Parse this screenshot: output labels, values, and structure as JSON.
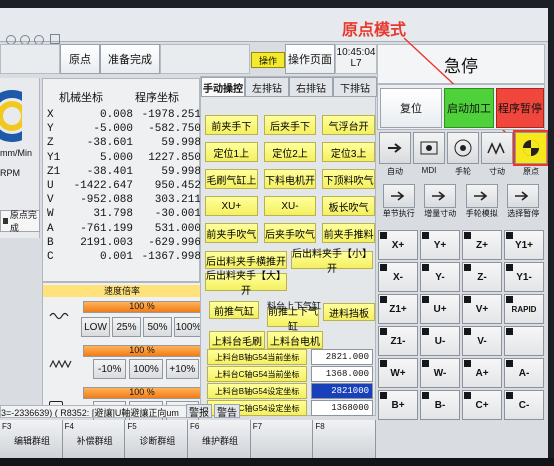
{
  "overlay_title": "原点模式",
  "header": {
    "origin": "原点",
    "ready": "准备完成",
    "op_badge": "操作",
    "op_page": "操作页面",
    "time": "10:45:04",
    "line": "L7",
    "estop": "急停"
  },
  "left_info": {
    "speed_unit": "mm/Min",
    "rpm": "RPM",
    "origin_done": "原点完成"
  },
  "coords": {
    "mech_header": "机械坐标",
    "prog_header": "程序坐标",
    "rows": [
      {
        "axis": "X",
        "mech": "0.008",
        "prog": "-1978.251"
      },
      {
        "axis": "Y",
        "mech": "-5.000",
        "prog": "-582.750"
      },
      {
        "axis": "Z",
        "mech": "-38.601",
        "prog": "59.998"
      },
      {
        "axis": "Y1",
        "mech": "5.000",
        "prog": "1227.850"
      },
      {
        "axis": "Z1",
        "mech": "-38.401",
        "prog": "59.998"
      },
      {
        "axis": "U",
        "mech": "-1422.647",
        "prog": "950.452"
      },
      {
        "axis": "V",
        "mech": "-952.088",
        "prog": "303.211"
      },
      {
        "axis": "W",
        "mech": "31.798",
        "prog": "-30.001"
      },
      {
        "axis": "A",
        "mech": "-761.199",
        "prog": "531.000"
      },
      {
        "axis": "B",
        "mech": "2191.003",
        "prog": "-629.996"
      },
      {
        "axis": "C",
        "mech": "0.001",
        "prog": "-1367.998"
      }
    ]
  },
  "override": {
    "title": "速度倍率",
    "g1": {
      "value": "100 %",
      "fill": 1.0,
      "buttons": [
        "LOW",
        "25%",
        "50%",
        "100%"
      ]
    },
    "g2": {
      "value": "100 %",
      "fill": 1.0,
      "buttons": [
        "-10%",
        "100%",
        "+10%"
      ]
    },
    "g3": {
      "value": "100 %",
      "fill": 1.0,
      "buttons": [
        "-10%",
        "100%",
        "+10%"
      ]
    }
  },
  "tabs": [
    "手动操控",
    "左排钻",
    "右排钻",
    "下排钻"
  ],
  "manual_buttons": [
    [
      "前夹手下",
      "后夹手下",
      "气浮台开"
    ],
    [
      "定位1上",
      "定位2上",
      "定位3上"
    ],
    [
      "毛刷气缸上",
      "下料电机开",
      "下顶料吹气"
    ],
    [
      "XU+",
      "XU-",
      "板长吹气"
    ],
    [
      "前夹手吹气",
      "后夹手吹气",
      "前夹手推料"
    ]
  ],
  "wide_buttons": [
    "后出料夹手横推开",
    "后出料夹手【小】开",
    "后出料夹手【大】开"
  ],
  "lower_buttons": {
    "front_cyl": "前推气缸",
    "up_down_header": "料台上下气缸",
    "front_updown": "前推上下气缸",
    "stop_block": "进料挡板",
    "brush": "上料台毛刷",
    "motor": "上料台电机"
  },
  "setting_rows": [
    {
      "label": "上料台B轴G54当前坐标",
      "value": "2821.000"
    },
    {
      "label": "上料台C轴G54当前坐标",
      "value": "1368.000"
    },
    {
      "label": "上料台B轴G54设定坐标",
      "value": "2821000"
    },
    {
      "label": "上料台C轴G54设定坐标",
      "value": "1368000"
    }
  ],
  "status_line": "3=-2336639) ( R8352: [避讓]U軸避讓正向um",
  "status_tabs": [
    "警报",
    "警告"
  ],
  "fkeys": [
    {
      "key": "F3",
      "label": "编辑群组"
    },
    {
      "key": "F4",
      "label": "补偿群组"
    },
    {
      "key": "F5",
      "label": "诊断群组"
    },
    {
      "key": "F6",
      "label": "维护群组"
    },
    {
      "key": "F7",
      "label": ""
    },
    {
      "key": "F8",
      "label": ""
    }
  ],
  "right_panel": {
    "reset": "复位",
    "start": "启动加工",
    "pause": "程序暂停",
    "modes": [
      "自动",
      "MDI",
      "手轮",
      "寸动",
      "原点"
    ],
    "modes2": [
      "单节执行",
      "增量寸动",
      "手轮模拟",
      "选择暂停"
    ],
    "jog": [
      [
        "X+",
        "Y+",
        "Z+",
        "Y1+"
      ],
      [
        "X-",
        "Y-",
        "Z-",
        "Y1-"
      ],
      [
        "Z1+",
        "U+",
        "V+",
        "RAPID"
      ],
      [
        "Z1-",
        "U-",
        "V-",
        ""
      ],
      [
        "W+",
        "W-",
        "A+",
        "A-"
      ],
      [
        "B+",
        "B-",
        "C+",
        "C-"
      ]
    ]
  },
  "colors": {
    "green": "#4fd13a",
    "red": "#f0463c",
    "yellow": "#f7f36a",
    "orange": "#f38e2a",
    "accent_red": "#e8392e"
  }
}
